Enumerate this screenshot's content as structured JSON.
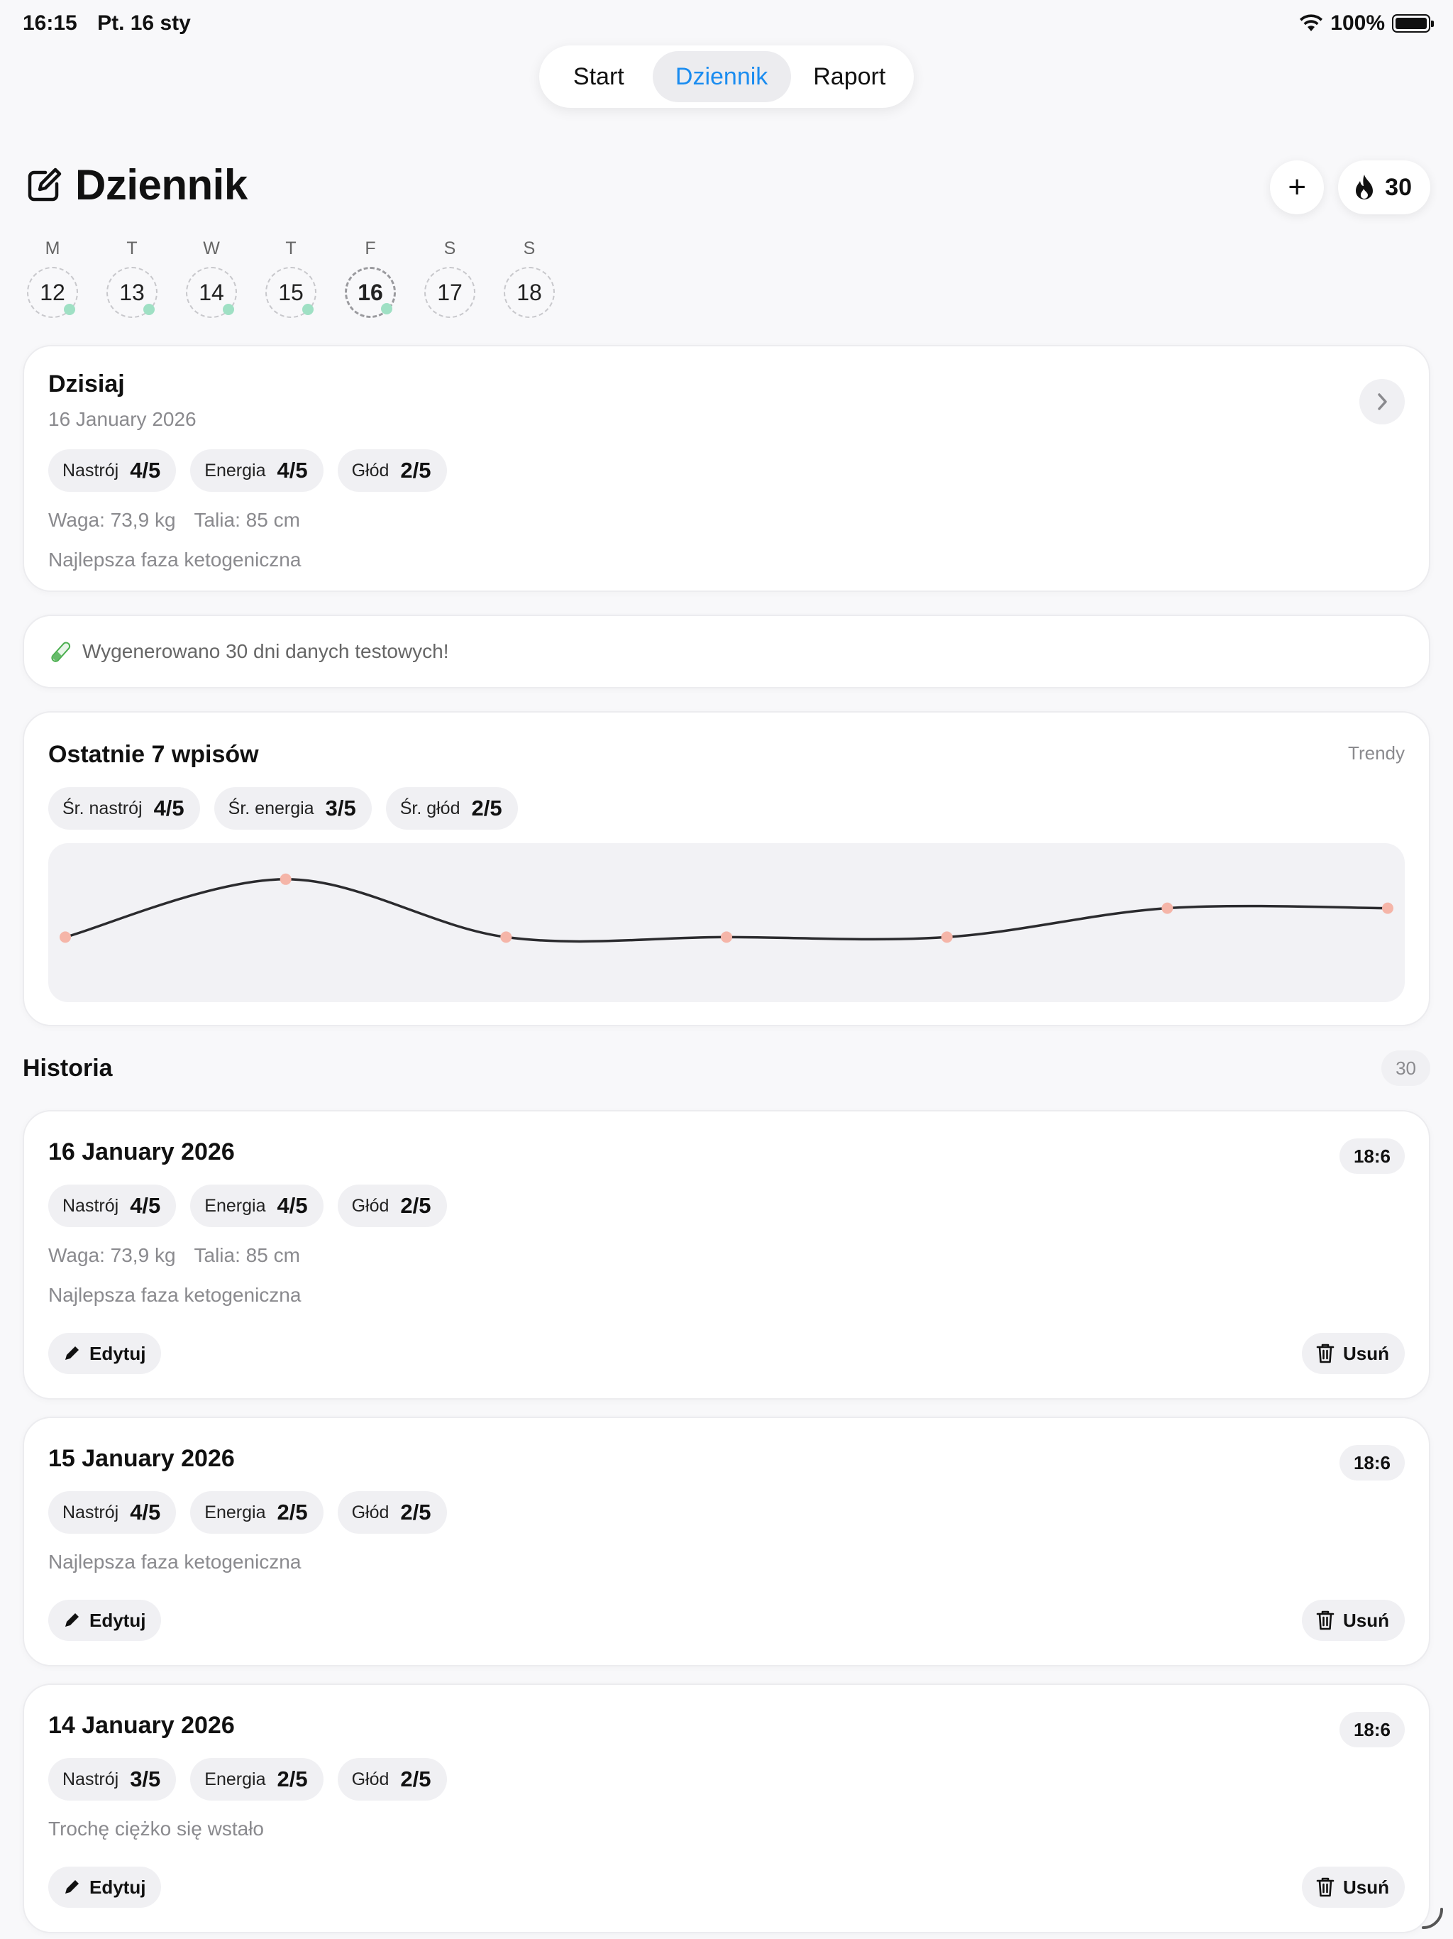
{
  "status": {
    "time": "16:15",
    "date": "Pt. 16 sty",
    "battery": "100%"
  },
  "nav": {
    "tabs": [
      "Start",
      "Dziennik",
      "Raport"
    ],
    "active": "Dziennik"
  },
  "header": {
    "title": "Dziennik",
    "add_label": "+",
    "streak_count": "30"
  },
  "week": [
    {
      "letter": "M",
      "day": "12",
      "logged": true
    },
    {
      "letter": "T",
      "day": "13",
      "logged": true
    },
    {
      "letter": "W",
      "day": "14",
      "logged": true
    },
    {
      "letter": "T",
      "day": "15",
      "logged": true
    },
    {
      "letter": "F",
      "day": "16",
      "logged": true,
      "today": true
    },
    {
      "letter": "S",
      "day": "17",
      "logged": false
    },
    {
      "letter": "S",
      "day": "18",
      "logged": false
    }
  ],
  "today": {
    "title": "Dzisiaj",
    "date": "16 January 2026",
    "chips": [
      {
        "label": "Nastrój",
        "value": "4/5"
      },
      {
        "label": "Energia",
        "value": "4/5"
      },
      {
        "label": "Głód",
        "value": "2/5"
      }
    ],
    "weight": "Waga: 73,9 kg",
    "waist": "Talia: 85 cm",
    "note": "Najlepsza faza ketogeniczna"
  },
  "info": {
    "message": "Wygenerowano 30 dni danych testowych!"
  },
  "recent": {
    "title": "Ostatnie 7 wpisów",
    "link": "Trendy",
    "chips": [
      {
        "label": "Śr. nastrój",
        "value": "4/5"
      },
      {
        "label": "Śr. energia",
        "value": "3/5"
      },
      {
        "label": "Śr. głód",
        "value": "2/5"
      }
    ]
  },
  "chart_data": {
    "type": "line",
    "x": [
      1,
      2,
      3,
      4,
      5,
      6,
      7
    ],
    "values": [
      3,
      5,
      3,
      3,
      3,
      4,
      4
    ],
    "ylim": [
      1,
      6
    ],
    "line_color": "#2b2b2e",
    "point_color": "#f5b5a8"
  },
  "history": {
    "title": "Historia",
    "count": "30",
    "entries": [
      {
        "date": "16 January 2026",
        "time": "18:6",
        "chips": [
          {
            "label": "Nastrój",
            "value": "4/5"
          },
          {
            "label": "Energia",
            "value": "4/5"
          },
          {
            "label": "Głód",
            "value": "2/5"
          }
        ],
        "weight": "Waga: 73,9 kg",
        "waist": "Talia: 85 cm",
        "note": "Najlepsza faza ketogeniczna",
        "edit": "Edytuj",
        "delete": "Usuń"
      },
      {
        "date": "15 January 2026",
        "time": "18:6",
        "chips": [
          {
            "label": "Nastrój",
            "value": "4/5"
          },
          {
            "label": "Energia",
            "value": "2/5"
          },
          {
            "label": "Głód",
            "value": "2/5"
          }
        ],
        "note": "Najlepsza faza ketogeniczna",
        "edit": "Edytuj",
        "delete": "Usuń"
      },
      {
        "date": "14 January 2026",
        "time": "18:6",
        "chips": [
          {
            "label": "Nastrój",
            "value": "3/5"
          },
          {
            "label": "Energia",
            "value": "2/5"
          },
          {
            "label": "Głód",
            "value": "2/5"
          }
        ],
        "note": "Trochę ciężko się wstało",
        "edit": "Edytuj",
        "delete": "Usuń"
      }
    ]
  },
  "colors": {
    "accent": "#1a8cf0",
    "logged_dot": "#9fe0c4",
    "background": "#f8f8fa"
  }
}
